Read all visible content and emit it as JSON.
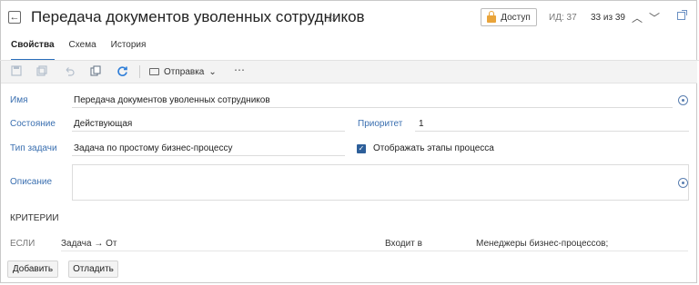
{
  "header": {
    "back_glyph": "←",
    "title": "Передача документов уволенных сотрудников",
    "star_glyph": "☆",
    "access_label": "Доступ",
    "id_label": "ИД: 37",
    "counter": "33 из 39",
    "nav_up_glyph": "︿",
    "nav_down_glyph": "﹀"
  },
  "tabs": [
    {
      "label": "Свойства",
      "active": true
    },
    {
      "label": "Схема",
      "active": false
    },
    {
      "label": "История",
      "active": false
    }
  ],
  "toolbar": {
    "send_label": "Отправка",
    "send_caret": "⌄",
    "more_glyph": "⋯"
  },
  "form": {
    "name_label": "Имя",
    "name_value": "Передача документов уволенных сотрудников",
    "state_label": "Состояние",
    "state_value": "Действующая",
    "priority_label": "Приоритет",
    "priority_value": "1",
    "task_type_label": "Тип задачи",
    "task_type_value": "Задача по простому бизнес-процессу",
    "show_stages_label": "Отображать этапы процесса",
    "show_stages_checked": true,
    "description_label": "Описание",
    "description_value": ""
  },
  "criteria": {
    "title": "КРИТЕРИИ",
    "if_label": "ЕСЛИ",
    "subject": "Задача → От",
    "operator": "Входит в",
    "value": "Менеджеры бизнес-процессов;"
  },
  "buttons": {
    "add": "Добавить",
    "debug": "Отладить"
  },
  "colors": {
    "accent": "#2a6ebb",
    "label": "#3a6fb0",
    "lock": "#e9a43a",
    "checkbox": "#2d5f9a"
  }
}
